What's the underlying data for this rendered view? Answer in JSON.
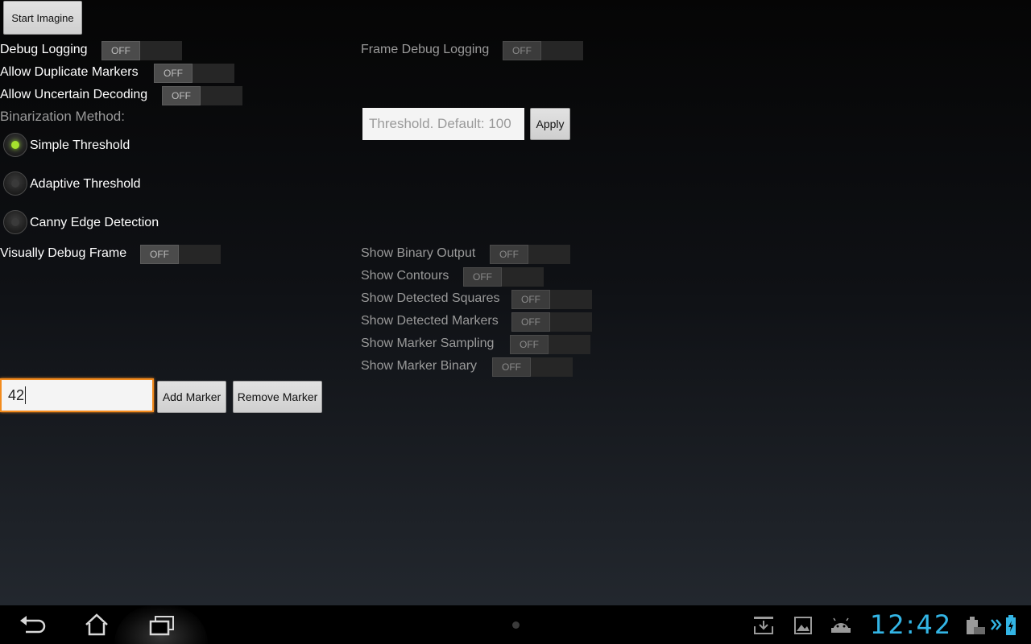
{
  "buttons": {
    "start": "Start Imagine",
    "apply": "Apply",
    "add_marker": "Add Marker",
    "remove_marker": "Remove Marker"
  },
  "settings": {
    "debug_logging": "Debug Logging",
    "frame_debug_logging": "Frame Debug Logging",
    "allow_duplicate_markers": "Allow Duplicate Markers",
    "allow_uncertain_decoding": "Allow Uncertain Decoding",
    "binarization_method": "Binarization Method:",
    "visually_debug_frame": "Visually Debug Frame",
    "toggle_off": "OFF"
  },
  "radio_options": {
    "simple": "Simple Threshold",
    "adaptive": "Adaptive Threshold",
    "canny": "Canny Edge Detection",
    "selected": "Simple Threshold"
  },
  "threshold": {
    "placeholder": "Threshold. Default: 100"
  },
  "visual_debug": {
    "show_binary_output": "Show Binary Output",
    "show_contours": "Show Contours",
    "show_detected_squares": "Show Detected Squares",
    "show_detected_markers": "Show Detected Markers",
    "show_marker_sampling": "Show Marker Sampling",
    "show_marker_binary": "Show Marker Binary"
  },
  "marker": {
    "value": "42"
  },
  "status_bar": {
    "time": "12:42",
    "icons": [
      "back-icon",
      "home-icon",
      "recent-apps-icon",
      "download-icon",
      "gallery-icon",
      "android-icon",
      "keyboard-icon",
      "chevron-icon",
      "battery-icon"
    ]
  },
  "colors": {
    "accent_orange": "#f38b1d",
    "radio_green": "#a6e22e",
    "clock_blue": "#33b5e5"
  }
}
